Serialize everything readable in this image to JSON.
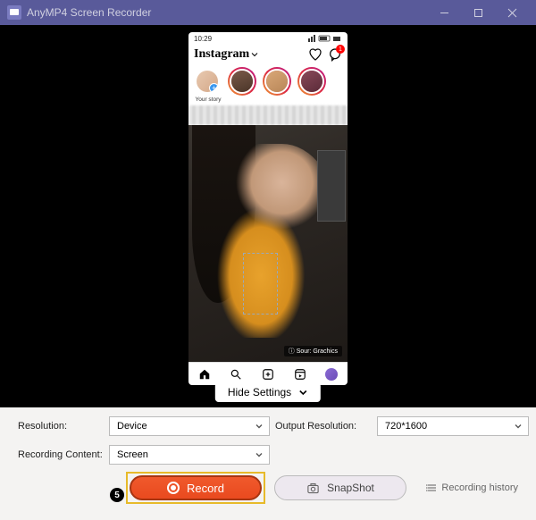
{
  "titlebar": {
    "title": "AnyMP4 Screen Recorder"
  },
  "phone": {
    "time": "10:29",
    "app_logo": "Instagram",
    "notification_count": "1",
    "stories": [
      {
        "label": "Your story",
        "ring": "blue",
        "add": true,
        "bg": "linear-gradient(135deg,#e8c9b0,#d4a888)"
      },
      {
        "label": "",
        "ring": "gradient",
        "bg": "linear-gradient(160deg,#7a5a4a,#4a3528)"
      },
      {
        "label": "",
        "ring": "gradient",
        "bg": "linear-gradient(150deg,#d9a878,#b88658)"
      },
      {
        "label": "",
        "ring": "gradient",
        "bg": "linear-gradient(150deg,#8a4a5a,#5a2a38)"
      }
    ],
    "feed_credit": "ⓘ Sour: Grachics"
  },
  "hide_settings": {
    "label": "Hide Settings"
  },
  "settings": {
    "resolution_label": "Resolution:",
    "resolution_value": "Device",
    "output_res_label": "Output Resolution:",
    "output_res_value": "720*1600",
    "content_label": "Recording Content:",
    "content_value": "Screen"
  },
  "buttons": {
    "step_number": "5",
    "record": "Record",
    "snapshot": "SnapShot",
    "history": "Recording history"
  }
}
